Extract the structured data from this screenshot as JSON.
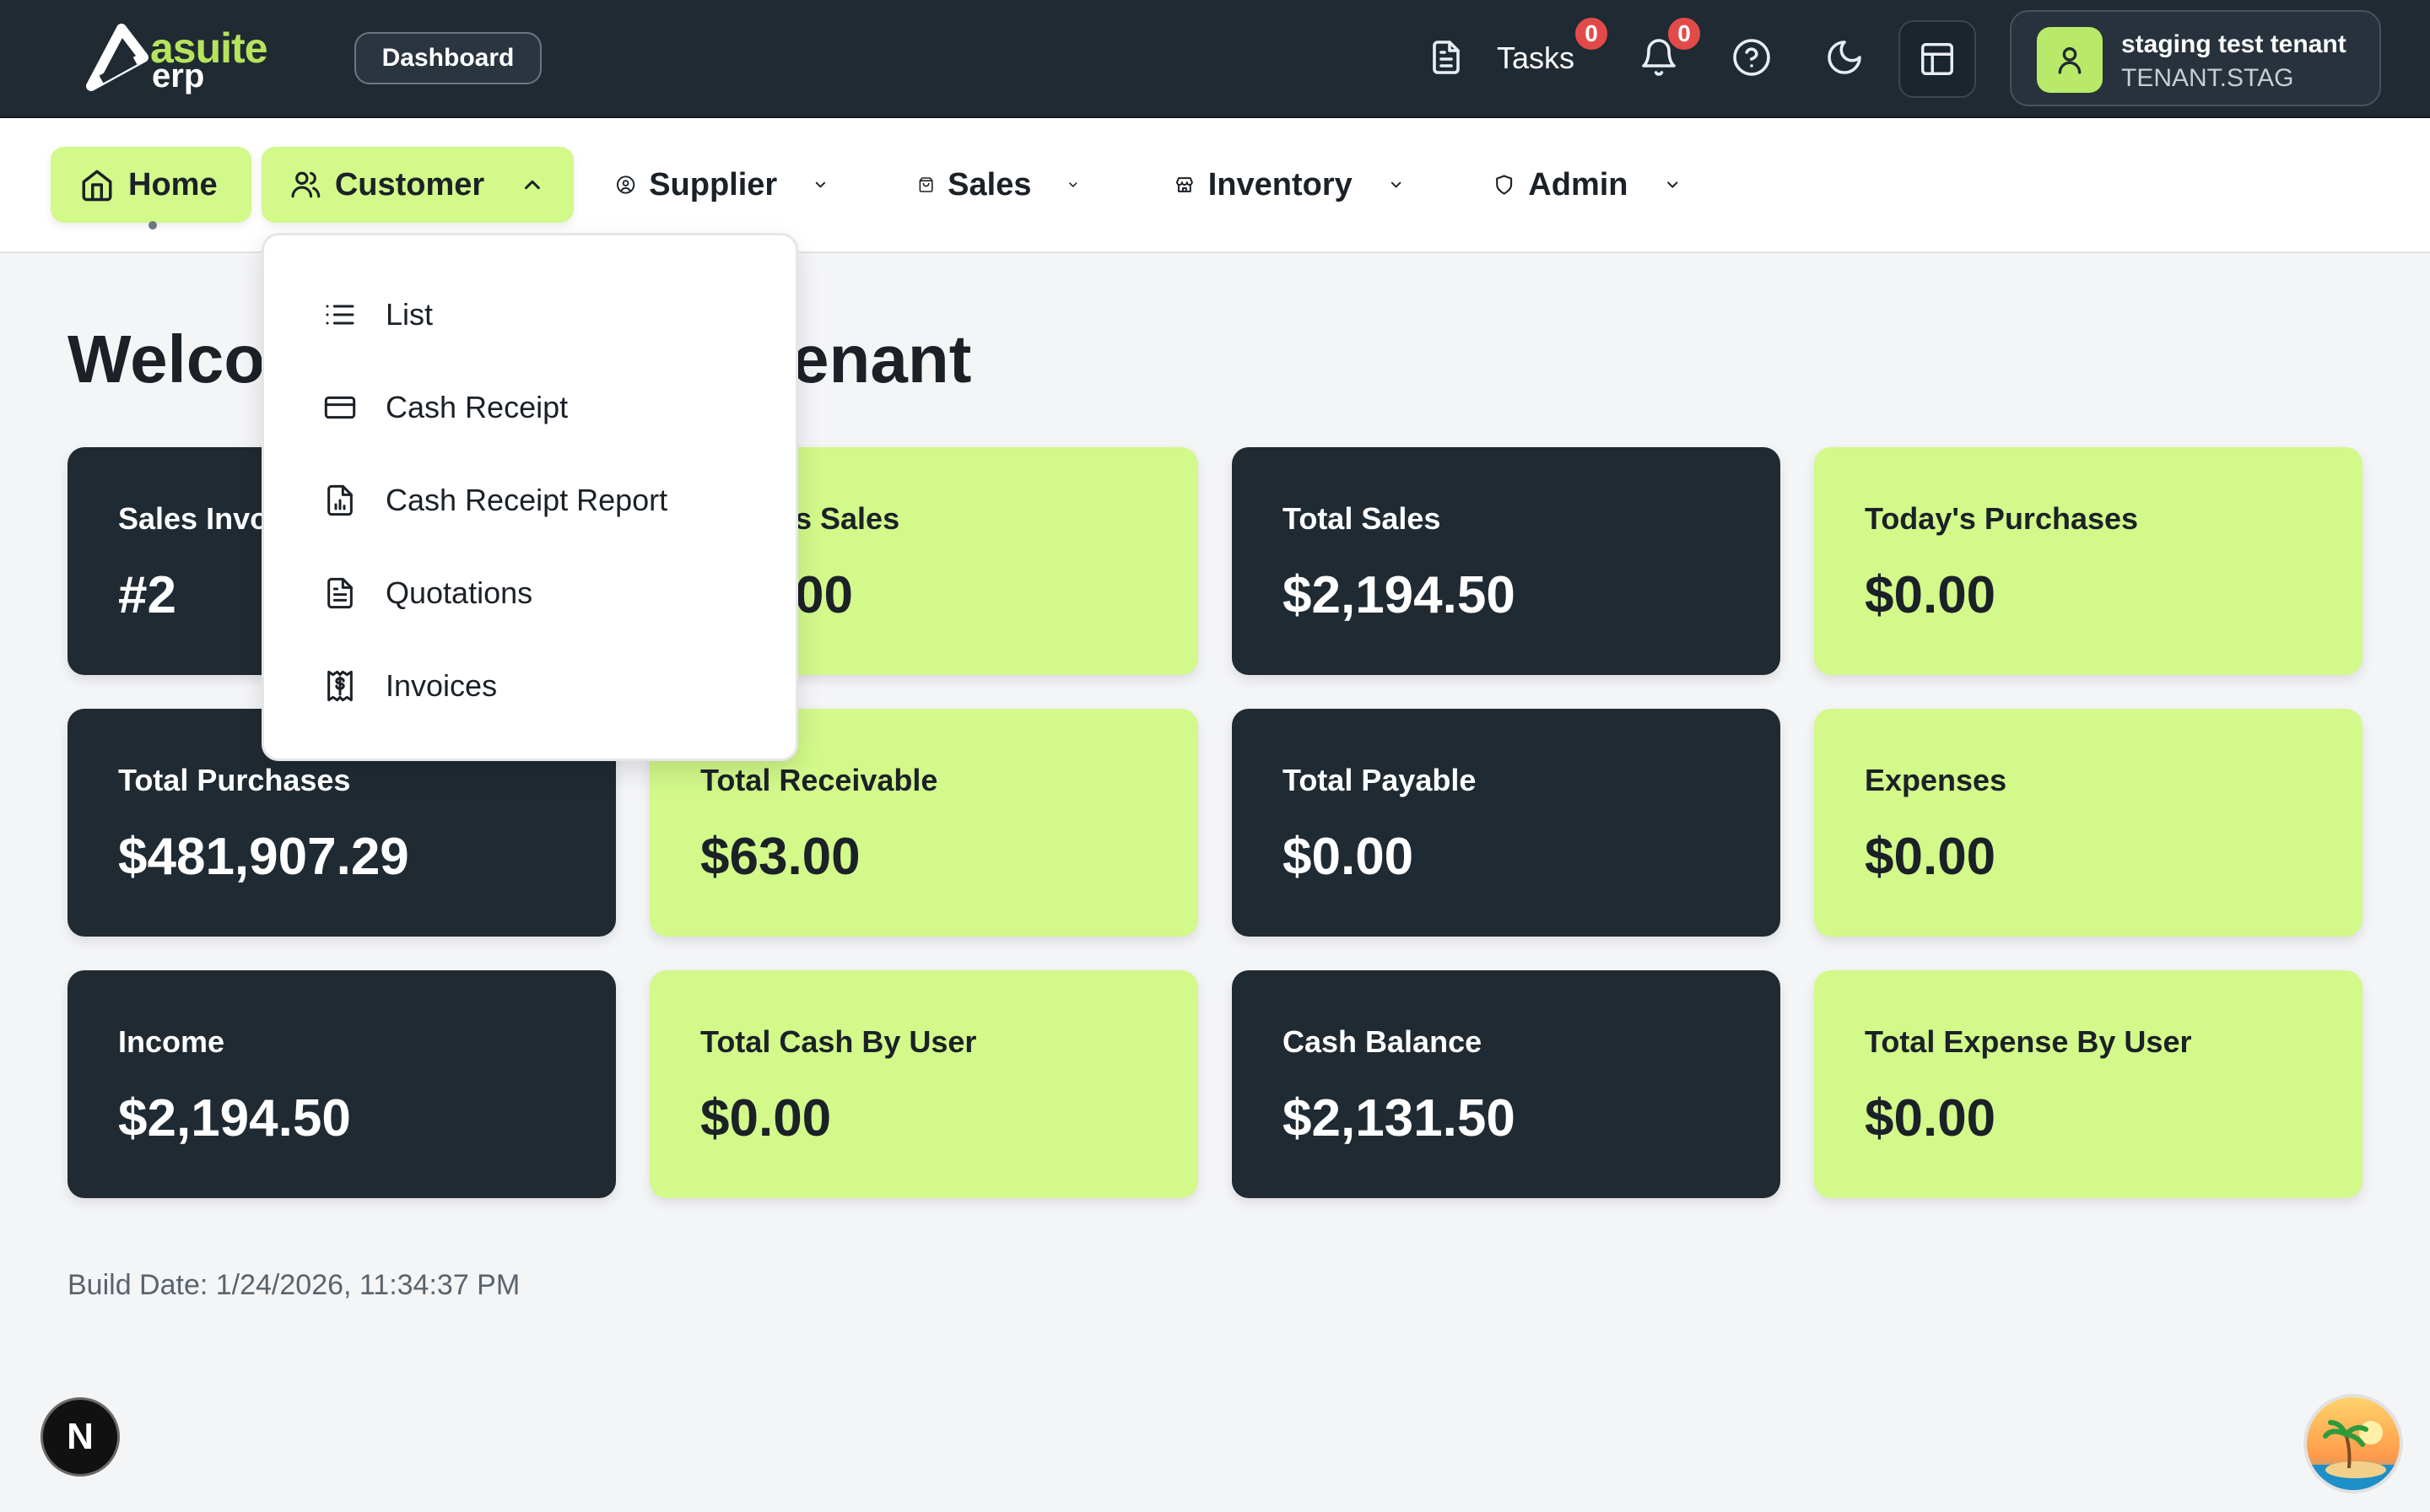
{
  "topbar": {
    "logo_primary": "asuite",
    "logo_secondary": "erp",
    "dashboard_label": "Dashboard",
    "tasks_label": "Tasks",
    "tasks_badge": "0",
    "notifications_badge": "0",
    "user_name": "staging test tenant",
    "user_code": "TENANT.STAG"
  },
  "nav": {
    "items": [
      {
        "label": "Home",
        "icon": "home-icon"
      },
      {
        "label": "Customer",
        "icon": "users-icon"
      },
      {
        "label": "Supplier",
        "icon": "user-circle-icon"
      },
      {
        "label": "Sales",
        "icon": "shopping-bag-icon"
      },
      {
        "label": "Inventory",
        "icon": "store-icon"
      },
      {
        "label": "Admin",
        "icon": "shield-icon"
      }
    ]
  },
  "dropdown": {
    "items": [
      {
        "label": "List",
        "icon": "list-icon"
      },
      {
        "label": "Cash Receipt",
        "icon": "credit-card-icon"
      },
      {
        "label": "Cash Receipt Report",
        "icon": "file-chart-icon"
      },
      {
        "label": "Quotations",
        "icon": "file-text-icon"
      },
      {
        "label": "Invoices",
        "icon": "receipt-icon"
      }
    ]
  },
  "welcome": {
    "left_text": "Welco",
    "right_text": "enant"
  },
  "cards": [
    {
      "title": "Sales Invo",
      "value": "#2",
      "theme": "dark"
    },
    {
      "title": "s Sales",
      "value": "00",
      "theme": "light"
    },
    {
      "title": "Total Sales",
      "value": "$2,194.50",
      "theme": "dark"
    },
    {
      "title": "Today's Purchases",
      "value": "$0.00",
      "theme": "light"
    },
    {
      "title": "Total Purchases",
      "value": "$481,907.29",
      "theme": "dark"
    },
    {
      "title": "Total Receivable",
      "value": "$63.00",
      "theme": "light"
    },
    {
      "title": "Total Payable",
      "value": "$0.00",
      "theme": "dark"
    },
    {
      "title": "Expenses",
      "value": "$0.00",
      "theme": "light"
    },
    {
      "title": "Income",
      "value": "$2,194.50",
      "theme": "dark"
    },
    {
      "title": "Total Cash By User",
      "value": "$0.00",
      "theme": "light"
    },
    {
      "title": "Cash Balance",
      "value": "$2,131.50",
      "theme": "dark"
    },
    {
      "title": "Total Expense By User",
      "value": "$0.00",
      "theme": "light"
    }
  ],
  "footer": {
    "build_date": "Build Date: 1/24/2026, 11:34:37 PM",
    "dev_badge": "N"
  },
  "colors": {
    "dark": "#1f2a33",
    "accent": "#d2f98a",
    "badge": "#e24a4a"
  }
}
